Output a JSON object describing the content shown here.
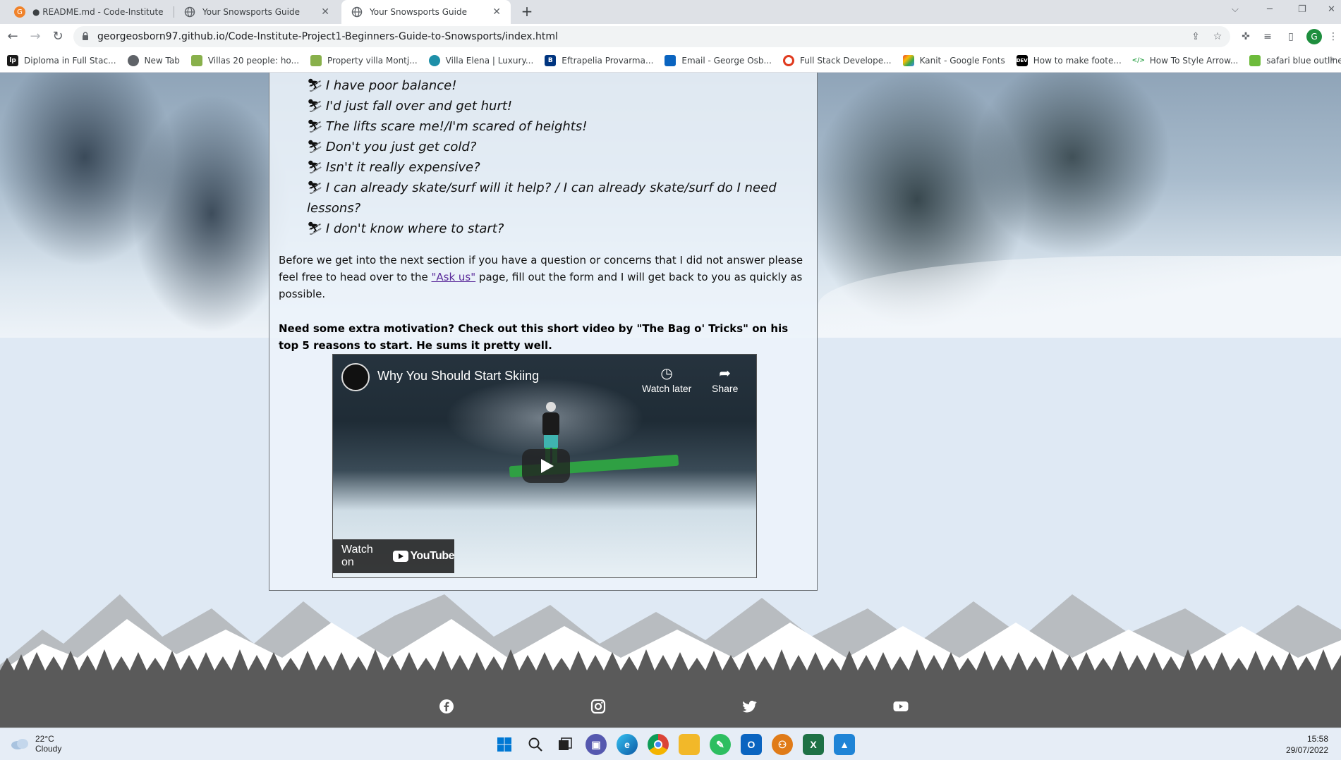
{
  "tabs": [
    {
      "title": "● README.md - Code-Institute-P",
      "icon": "gitpod-icon",
      "color": "#f0822a"
    },
    {
      "title": "Your Snowsports Guide",
      "icon": "globe-icon",
      "color": "#5f6368"
    },
    {
      "title": "Your Snowsports Guide",
      "icon": "globe-icon",
      "color": "#5f6368",
      "active": true
    }
  ],
  "address": {
    "url": "georgeosborn97.github.io/Code-Institute-Project1-Beginners-Guide-to-Snowsports/index.html"
  },
  "profile": {
    "initial": "G"
  },
  "bookmarks": [
    {
      "label": "Diploma in Full Stac...",
      "icon": "lp",
      "color": "#1a1a1a"
    },
    {
      "label": "New Tab",
      "icon": "",
      "color": "#5f6368"
    },
    {
      "label": "Villas 20 people: ho...",
      "icon": "",
      "color": "#88b04b"
    },
    {
      "label": "Property villa Montj...",
      "icon": "",
      "color": "#88b04b"
    },
    {
      "label": "Villa Elena | Luxury...",
      "icon": "",
      "color": "#1e8fa8"
    },
    {
      "label": "Eftrapelia Provarma...",
      "icon": "B",
      "color": "#003580"
    },
    {
      "label": "Email - George Osb...",
      "icon": "",
      "color": "#0a64c0"
    },
    {
      "label": "Full Stack Develope...",
      "icon": "",
      "color": "#e03a1e"
    },
    {
      "label": "Kanit - Google Fonts",
      "icon": "",
      "color": "#f4b400"
    },
    {
      "label": "How to make foote...",
      "icon": "DEV",
      "color": "#000000"
    },
    {
      "label": "How To Style Arrow...",
      "icon": "</>",
      "color": "#2aa146"
    },
    {
      "label": "safari blue outline r...",
      "icon": "",
      "color": "#6dbb3b"
    }
  ],
  "page": {
    "fears": [
      "I have poor balance!",
      "I'd just fall over and get hurt!",
      "The lifts scare me!/I'm scared of heights!",
      "Don't you just get cold?",
      "Isn't it really expensive?",
      "I can already skate/surf will it help? / I can already skate/surf do I need lessons?",
      "I don't know where to start?"
    ],
    "para_before": "Before we get into the next section if you have a question or concerns that I did not answer please feel free to head over to the ",
    "ask_link": "\"Ask us\"",
    "para_after": " page, fill out the form and I will get back to you as quickly as possible.",
    "motivation": "Need some extra motivation? Check out this short video by \"The Bag o' Tricks\" on his top 5 reasons to start. He sums it pretty well."
  },
  "video": {
    "title": "Why You Should Start Skiing",
    "watch_later": "Watch later",
    "share": "Share",
    "watch_on": "Watch on",
    "youtube": "YouTube"
  },
  "footer": {
    "social": [
      "facebook-icon",
      "instagram-icon",
      "twitter-icon",
      "youtube-icon"
    ]
  },
  "taskbar": {
    "temp": "22°C",
    "condition": "Cloudy",
    "time": "15:58",
    "date": "29/07/2022",
    "apps": [
      {
        "name": "windows-start-icon",
        "color": "#0078d4",
        "glyph": "⊞"
      },
      {
        "name": "search-icon",
        "color": "#e6edf6",
        "glyph": "○"
      },
      {
        "name": "task-view-icon",
        "color": "#e6edf6",
        "glyph": "▣"
      },
      {
        "name": "teams-chat-icon",
        "color": "#6264a7",
        "glyph": "◉"
      },
      {
        "name": "edge-icon",
        "color": "#0c8fb8",
        "glyph": "e"
      },
      {
        "name": "chrome-icon",
        "color": "#db4437",
        "glyph": "◎"
      },
      {
        "name": "file-explorer-icon",
        "color": "#f2b829",
        "glyph": "▭"
      },
      {
        "name": "evernote-icon",
        "color": "#2dbe60",
        "glyph": "✎"
      },
      {
        "name": "outlook-icon",
        "color": "#0a64c0",
        "glyph": "O"
      },
      {
        "name": "fitbit-icon",
        "color": "#e07b18",
        "glyph": "⚇"
      },
      {
        "name": "excel-icon",
        "color": "#1e7145",
        "glyph": "X"
      },
      {
        "name": "photos-icon",
        "color": "#1f84d6",
        "glyph": "▲"
      }
    ]
  }
}
